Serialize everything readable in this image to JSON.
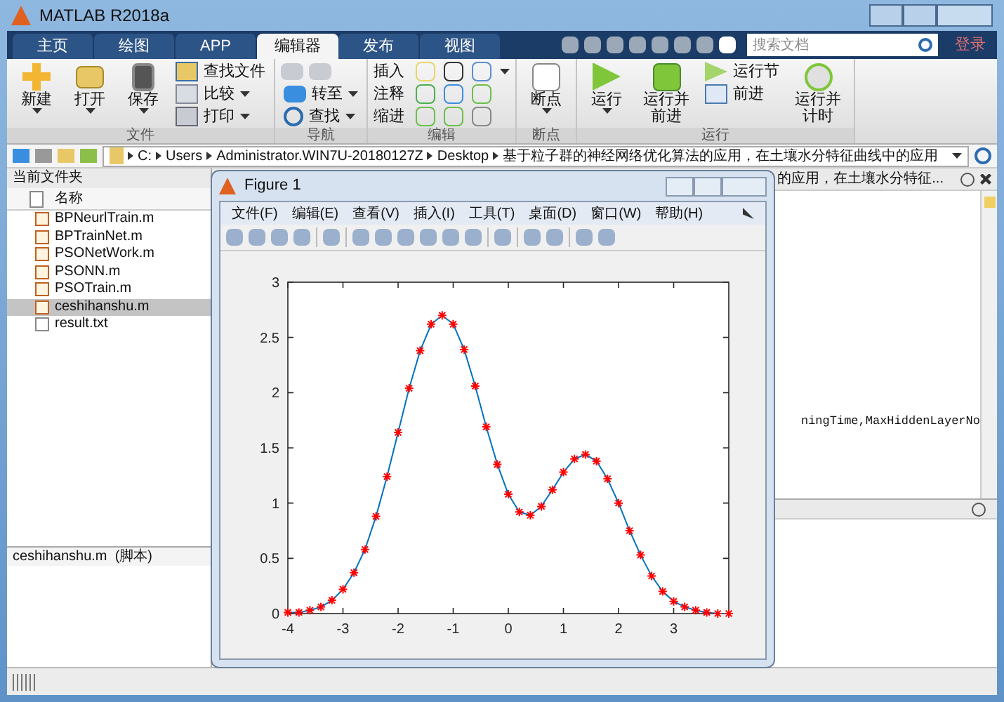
{
  "window": {
    "title": "MATLAB R2018a"
  },
  "ribbon_tabs": [
    {
      "label": "主页",
      "selected": false
    },
    {
      "label": "绘图",
      "selected": false
    },
    {
      "label": "APP",
      "selected": false
    },
    {
      "label": "编辑器",
      "selected": true
    },
    {
      "label": "发布",
      "selected": false
    },
    {
      "label": "视图",
      "selected": false
    }
  ],
  "quick_access": {
    "search": {
      "placeholder": "搜索文档"
    },
    "login": "登录"
  },
  "ribbon_groups": [
    {
      "title": "文件",
      "items": [
        {
          "kind": "large",
          "label": "新建",
          "dropdown": true
        },
        {
          "kind": "large",
          "label": "打开",
          "dropdown": true
        },
        {
          "kind": "large",
          "label": "保存",
          "dropdown": true
        },
        {
          "kind": "stack",
          "rows": [
            {
              "kind": "button",
              "label": "查找文件",
              "dropdown": false
            },
            {
              "kind": "button",
              "label": "比较",
              "dropdown": true
            },
            {
              "kind": "button",
              "label": "打印",
              "dropdown": true
            }
          ]
        }
      ]
    },
    {
      "title": "导航",
      "items": [
        {
          "kind": "stack",
          "rows": [
            {
              "kind": "arrows"
            },
            {
              "kind": "button",
              "label": "转至",
              "dropdown": true
            },
            {
              "kind": "button",
              "label": "查找",
              "dropdown": true
            }
          ]
        }
      ]
    },
    {
      "title": "编辑",
      "items": [
        {
          "kind": "grid",
          "rows": [
            {
              "label": "插入",
              "dropdown": true
            },
            {
              "label": "注释",
              "dropdown": false
            },
            {
              "label": "缩进",
              "dropdown": false
            }
          ]
        }
      ]
    },
    {
      "title": "断点",
      "items": [
        {
          "kind": "large",
          "label": "断点",
          "dropdown": true
        }
      ]
    },
    {
      "title": "运行",
      "items": [
        {
          "kind": "large",
          "label": "运行",
          "dropdown": true
        },
        {
          "kind": "large",
          "label": "运行并前进",
          "dropdown": false
        },
        {
          "kind": "stack",
          "rows": [
            {
              "kind": "button",
              "label": "运行节",
              "dropdown": false
            },
            {
              "kind": "button",
              "label": "前进",
              "dropdown": false
            }
          ]
        },
        {
          "kind": "large",
          "label": "运行并计时",
          "dropdown": false
        }
      ]
    }
  ],
  "address_bar": {
    "path": [
      "C:",
      "Users",
      "Administrator.WIN7U-20180127Z",
      "Desktop",
      "基于粒子群的神经网络优化算法的应用，在土壤水分特征曲线中的应用"
    ]
  },
  "current_folder": {
    "title": "当前文件夹",
    "column": "名称",
    "files": [
      {
        "name": "BPNeurlTrain.m",
        "kind": "script",
        "selected": false
      },
      {
        "name": "BPTrainNet.m",
        "kind": "script",
        "selected": false
      },
      {
        "name": "PSONetWork.m",
        "kind": "script",
        "selected": false
      },
      {
        "name": "PSONN.m",
        "kind": "script",
        "selected": false
      },
      {
        "name": "PSOTrain.m",
        "kind": "script",
        "selected": false
      },
      {
        "name": "ceshihanshu.m",
        "kind": "script",
        "selected": true
      },
      {
        "name": "result.txt",
        "kind": "text",
        "selected": false
      }
    ],
    "details": "ceshihanshu.m  (脚本)"
  },
  "editor": {
    "title": "的应用，在土壤水分特征...",
    "code_line": "ningTime,MaxHiddenLayerNo"
  },
  "figure": {
    "title": "Figure 1",
    "menu": [
      "文件(F)",
      "编辑(E)",
      "查看(V)",
      "插入(I)",
      "工具(T)",
      "桌面(D)",
      "窗口(W)",
      "帮助(H)"
    ],
    "chart_data": {
      "type": "line",
      "xlim": [
        -4,
        4
      ],
      "ylim": [
        0,
        3
      ],
      "xticks": [
        -4,
        -3,
        -2,
        -1,
        0,
        1,
        2,
        3
      ],
      "yticks": [
        {
          "value": 0,
          "label": "0"
        },
        {
          "value": 0.5,
          "label": "0.5"
        },
        {
          "value": 1,
          "label": "1"
        },
        {
          "value": 1.5,
          "label": "1.5"
        },
        {
          "value": 2,
          "label": "2"
        },
        {
          "value": 2.5,
          "label": "2.5"
        },
        {
          "value": 3,
          "label": "3"
        }
      ],
      "x": [
        -4,
        -3.8,
        -3.6,
        -3.4,
        -3.2,
        -3,
        -2.8,
        -2.6,
        -2.4,
        -2.2,
        -2,
        -1.8,
        -1.6,
        -1.4,
        -1.2,
        -1,
        -0.8,
        -0.6,
        -0.4,
        -0.2,
        0,
        0.2,
        0.4,
        0.6,
        0.8,
        1,
        1.2,
        1.4,
        1.6,
        1.8,
        2,
        2.2,
        2.4,
        2.6,
        2.8,
        3,
        3.2,
        3.4,
        3.6,
        3.8,
        4
      ],
      "series": [
        {
          "color": "#ff0000",
          "marker": "cross",
          "values": [
            0.01,
            0.01,
            0.03,
            0.06,
            0.12,
            0.22,
            0.37,
            0.58,
            0.88,
            1.24,
            1.64,
            2.04,
            2.38,
            2.62,
            2.7,
            2.62,
            2.39,
            2.06,
            1.69,
            1.35,
            1.08,
            0.92,
            0.89,
            0.97,
            1.12,
            1.28,
            1.4,
            1.44,
            1.38,
            1.22,
            1,
            0.75,
            0.53,
            0.34,
            0.2,
            0.11,
            0.06,
            0.03,
            0.01,
            0,
            0
          ]
        }
      ]
    }
  }
}
